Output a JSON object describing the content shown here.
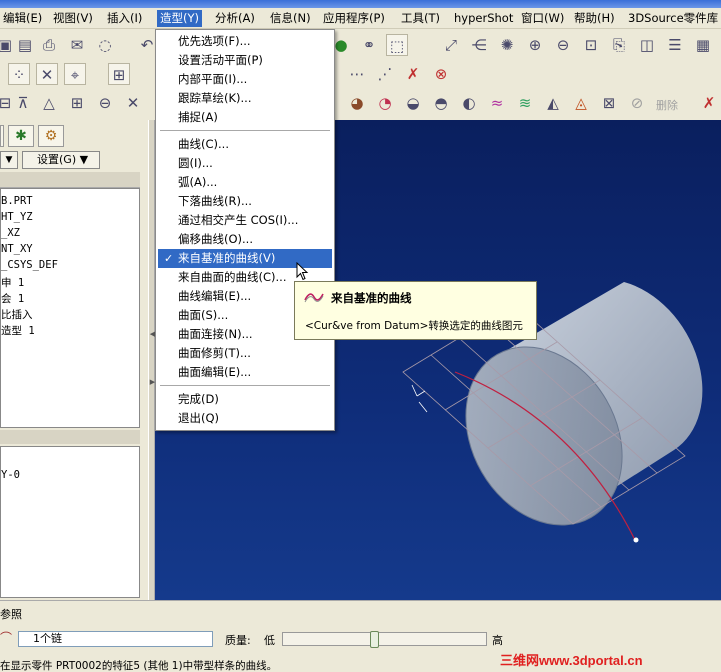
{
  "menubar": {
    "items": [
      {
        "label": "编辑(E)"
      },
      {
        "label": "视图(V)"
      },
      {
        "label": "插入(I)"
      },
      {
        "label": "造型(Y)"
      },
      {
        "label": "分析(A)"
      },
      {
        "label": "信息(N)"
      },
      {
        "label": "应用程序(P)"
      },
      {
        "label": "工具(T)"
      },
      {
        "label": "hyperShot"
      },
      {
        "label": "窗口(W)"
      },
      {
        "label": "帮助(H)"
      },
      {
        "label": "3DSource零件库"
      }
    ]
  },
  "dropdown": {
    "items": [
      {
        "label": "优先选项(F)..."
      },
      {
        "label": "设置活动平面(P)"
      },
      {
        "label": "内部平面(I)..."
      },
      {
        "label": "跟踪草绘(K)..."
      },
      {
        "label": "捕捉(A)"
      },
      {
        "label": "曲线(C)..."
      },
      {
        "label": "圆(I)..."
      },
      {
        "label": "弧(A)..."
      },
      {
        "label": "下落曲线(R)..."
      },
      {
        "label": "通过相交产生 COS(I)..."
      },
      {
        "label": "偏移曲线(O)..."
      },
      {
        "label": "来自基准的曲线(V)"
      },
      {
        "label": "来自曲面的曲线(C)..."
      },
      {
        "label": "曲线编辑(E)..."
      },
      {
        "label": "曲面(S)..."
      },
      {
        "label": "曲面连接(N)..."
      },
      {
        "label": "曲面修剪(T)..."
      },
      {
        "label": "曲面编辑(E)..."
      },
      {
        "label": "完成(D)"
      },
      {
        "label": "退出(Q)"
      }
    ],
    "check_mark": "✓"
  },
  "tooltip": {
    "title": "来自基准的曲线",
    "description": "<Cur&ve from Datum>转换选定的曲线图元"
  },
  "toolbar": {
    "delete_label": "删除"
  },
  "left_panel": {
    "settings_label": "设置(G)",
    "tree_items": [
      {
        "label": "B.PRT"
      },
      {
        "label": "HT_YZ"
      },
      {
        "label": "_XZ"
      },
      {
        "label": "NT_XY"
      },
      {
        "label": "_CSYS_DEF"
      },
      {
        "label": "申 1"
      },
      {
        "label": "会 1"
      },
      {
        "label": "比插入"
      },
      {
        "label": "造型 1"
      }
    ],
    "list_item": "Y-0"
  },
  "dashboard": {
    "section_label": "参照",
    "chain_value": "1个链",
    "quality_label": "质量:",
    "low_label": "低",
    "high_label": "高",
    "quality_value": 0.45
  },
  "statusbar": {
    "message": "在显示零件 PRT0002的特征5 (其他 1)中带型样条的曲线。"
  },
  "watermark": {
    "text": "三维网www.3dportal.cn"
  },
  "colors": {
    "menu_highlight": "#316ac5",
    "viewport_bg": "#0f2d7a",
    "tooltip_bg": "#ffffe1",
    "watermark": "#e02020"
  }
}
